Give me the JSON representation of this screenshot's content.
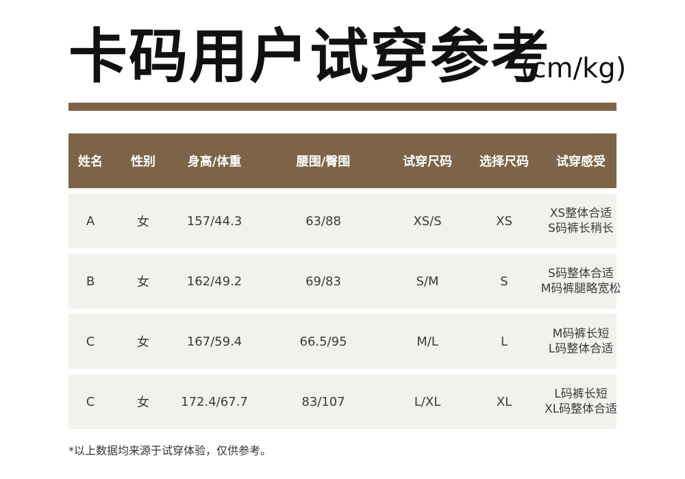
{
  "title": "卡码用户试穿参考",
  "unit": "(cm/kg)",
  "table": {
    "headers": [
      "姓名",
      "性别",
      "身高/体重",
      "腰围/臀围",
      "试穿尺码",
      "选择尺码",
      "试穿感受"
    ],
    "rows": [
      {
        "name": "A",
        "gender": "女",
        "height_weight": "157/44.3",
        "waist_hip": "63/88",
        "tried_size": "XS/S",
        "chosen_size": "XS",
        "feel": [
          "XS整体合适",
          "S码裤长稍长"
        ]
      },
      {
        "name": "B",
        "gender": "女",
        "height_weight": "162/49.2",
        "waist_hip": "69/83",
        "tried_size": "S/M",
        "chosen_size": "S",
        "feel": [
          "S码整体合适",
          "M码裤腿略宽松"
        ]
      },
      {
        "name": "C",
        "gender": "女",
        "height_weight": "167/59.4",
        "waist_hip": "66.5/95",
        "tried_size": "M/L",
        "chosen_size": "L",
        "feel": [
          "M码裤长短",
          "L码整体合适"
        ]
      },
      {
        "name": "C",
        "gender": "女",
        "height_weight": "172.4/67.7",
        "waist_hip": "83/107",
        "tried_size": "L/XL",
        "chosen_size": "XL",
        "feel": [
          "L码裤长短",
          "XL码整体合适"
        ]
      }
    ]
  },
  "footnote": "*以上数据均来源于试穿体验，仅供参考。",
  "colors": {
    "accent": "#7d6448",
    "row_bg": "#f2f1ec"
  }
}
